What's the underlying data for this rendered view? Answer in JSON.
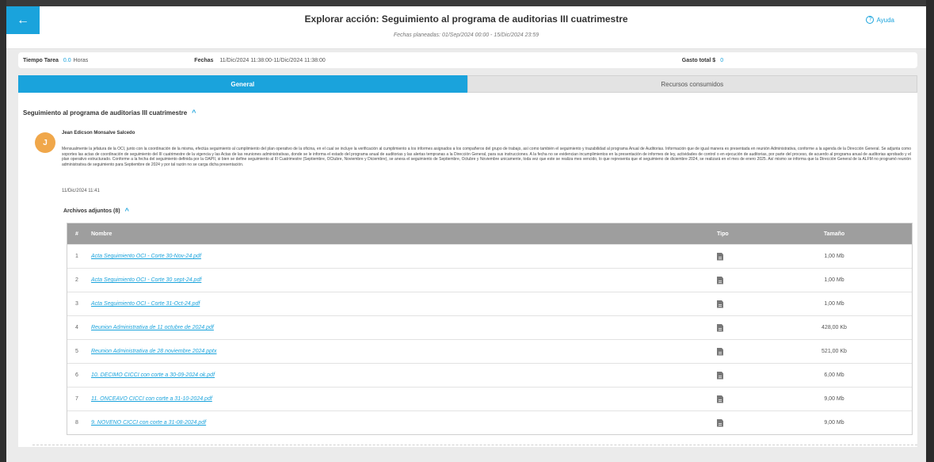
{
  "header": {
    "back_icon": "arrow-left-icon",
    "back_glyph": "←",
    "title": "Explorar acción: Seguimiento al programa de auditorias III cuatrimestre",
    "subtitle": "Fechas planeadas: 01/Sep/2024 00:00 - 15/Dic/2024 23:59",
    "help_icon": "question-circle-icon",
    "help_glyph": "?",
    "help_label": "Ayuda"
  },
  "info": {
    "tiempo_label": "Tiempo Tarea",
    "tiempo_value": "0.0",
    "tiempo_unit": "Horas",
    "fechas_label": "Fechas",
    "fechas_value": "11/Dic/2024 11:38:00-11/Dic/2024 11:38:00",
    "gasto_label": "Gasto total $",
    "gasto_value": "0"
  },
  "tabs": [
    {
      "label": "General",
      "active": true
    },
    {
      "label": "Recursos consumidos",
      "active": false
    }
  ],
  "section": {
    "title": "Seguimiento al programa de auditorias III cuatrimestre",
    "chevron": "^",
    "avatar_initial": "J",
    "author": "Jean Edicson Monsalve Salcedo",
    "description": "Mensualmente la jefatura de la OCI, junto con la coordinación de la misma, efectúa seguimiento al cumplimiento del plan operativo de la oficina, en el cual se incluye la verificación al cumplimiento a los informes asignados a los compañeros del grupo de trabajo, así como también el seguimiento y trazabilidad al programa Anual de Auditorias. Información que de igual manera es presentada en reunión Administrativa, conforme a la agenda de la Dirección General. Se adjunta como soportes las actas de coordinación de seguimiento del III cuatrimestre de la vigencia y las Actas de las reuniones administrativas, donde se le informa el estado del programa anual de auditorias y las alertas tempranas a la Dirección General, para sus instrucciones. A la fecha no se evidencian incumplimientos en la presentación de informes de ley, actividades de control o en ejecución de auditorias, por parte del proceso, de acuerdo al programa anual de auditorias aprobado y el plan operativo estructurado. Conforme a la fecha del seguimiento definida por la OAPII, si bien se define seguimiento al III Cuatrimestre (Septiembre, OCtubre, Noviembre y Diciembre), se anexa el seguimiento de Septiembre, Octubre y Noviembre unicamente, toda vez que este se realiza mes vencido, lo que representa que el seguimieno de diciembre 2024, se realizará en el mes de enero 2025. Así mismo se informa que la Dirección General de la ALFM no programó reunión administrativa de seguimiento para Septiembre de 2024 y por tal razón no se carga dicha presentación.",
    "date": "11/Dic/2024 11:41"
  },
  "attachments": {
    "title": "Archivos adjuntos (8)",
    "chevron": "^",
    "headers": {
      "num": "#",
      "name": "Nombre",
      "type": "Tipo",
      "size": "Tamaño"
    },
    "file_icon": "document-icon",
    "rows": [
      {
        "num": "1",
        "name": "Acta Seguimiento OCI - Corte 30-Nov-24.pdf",
        "size": "1,00 Mb"
      },
      {
        "num": "2",
        "name": "Acta Seguimiento OCI - Corte 30 sept-24.pdf",
        "size": "1,00 Mb"
      },
      {
        "num": "3",
        "name": "Acta Seguimiento OCI - Corte 31-Oct-24.pdf",
        "size": "1,00 Mb"
      },
      {
        "num": "4",
        "name": "Reunion Administrativa de 11 octubre de 2024.pdf",
        "size": "428,00 Kb"
      },
      {
        "num": "5",
        "name": "Reunion Administrativa de 28 noviembre 2024.pptx",
        "size": "521,00 Kb"
      },
      {
        "num": "6",
        "name": "10. DECIMO CICCI con corte a 30-09-2024 ok.pdf",
        "size": "6,00 Mb"
      },
      {
        "num": "7",
        "name": "11. ONCEAVO CICCI con corte a 31-10-2024.pdf",
        "size": "9,00 Mb"
      },
      {
        "num": "8",
        "name": "9. NOVENO CICCI con corte a 31-08-2024.pdf",
        "size": "9,00 Mb"
      }
    ]
  }
}
